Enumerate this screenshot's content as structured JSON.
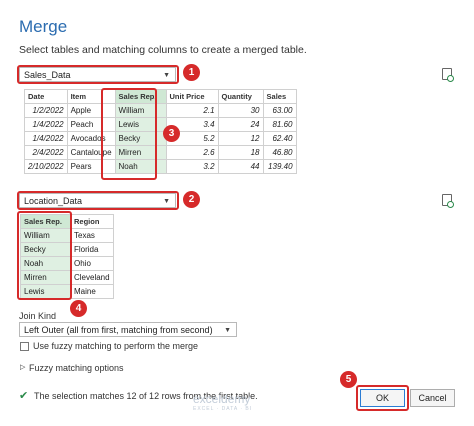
{
  "dialog": {
    "title": "Merge",
    "subtitle": "Select tables and matching columns to create a merged table."
  },
  "first_table": {
    "selected": "Sales_Data",
    "columns": [
      "Date",
      "Item",
      "Sales Rep.",
      "Unit Price",
      "Quantity",
      "Sales"
    ],
    "rows": [
      [
        "1/2/2022",
        "Apple",
        "William",
        "2.1",
        "30",
        "63.00"
      ],
      [
        "1/4/2022",
        "Peach",
        "Lewis",
        "3.4",
        "24",
        "81.60"
      ],
      [
        "1/4/2022",
        "Avocados",
        "Becky",
        "5.2",
        "12",
        "62.40"
      ],
      [
        "2/4/2022",
        "Cantaloupe",
        "Mirren",
        "2.6",
        "18",
        "46.80"
      ],
      [
        "2/10/2022",
        "Pears",
        "Noah",
        "3.2",
        "44",
        "139.40"
      ]
    ]
  },
  "second_table": {
    "selected": "Location_Data",
    "columns": [
      "Sales Rep.",
      "Region"
    ],
    "rows": [
      [
        "William",
        "Texas"
      ],
      [
        "Becky",
        "Florida"
      ],
      [
        "Noah",
        "Ohio"
      ],
      [
        "Mirren",
        "Cleveland"
      ],
      [
        "Lewis",
        "Maine"
      ]
    ]
  },
  "join": {
    "label": "Join Kind",
    "selected": "Left Outer (all from first, matching from second)",
    "fuzzy_checkbox_label": "Use fuzzy matching to perform the merge",
    "fuzzy_options_label": "Fuzzy matching options"
  },
  "status": {
    "check_icon": "check-icon",
    "text": "The selection matches 12 of 12 rows from the first table."
  },
  "buttons": {
    "ok": "OK",
    "cancel": "Cancel"
  },
  "badges": [
    "1",
    "2",
    "3",
    "4",
    "5"
  ],
  "watermark": {
    "name": "exceldemy",
    "tagline": "EXCEL · DATA · BI"
  },
  "colors": {
    "accent": "#2b6cb0",
    "highlight": "#d62a2a",
    "selected_column": "#dff0e2"
  }
}
